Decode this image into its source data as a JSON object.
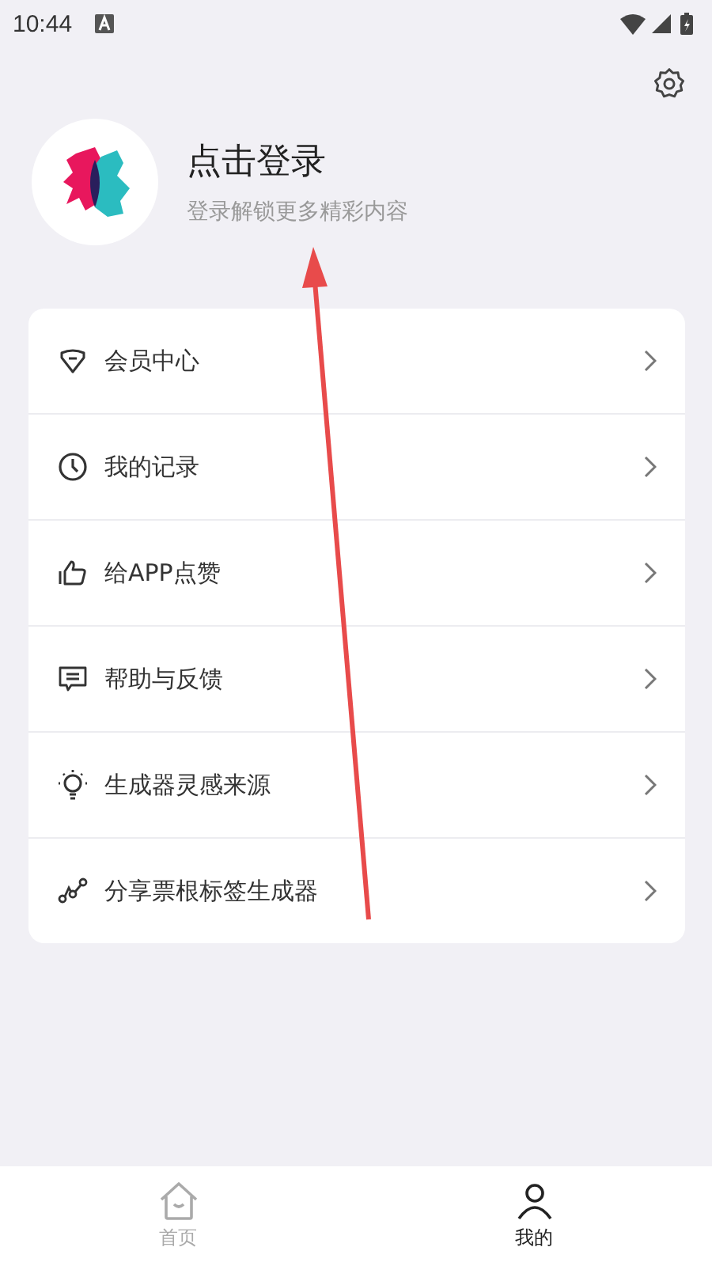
{
  "status_bar": {
    "time": "10:44"
  },
  "profile": {
    "title": "点击登录",
    "subtitle": "登录解锁更多精彩内容"
  },
  "menu": [
    {
      "kind": "member",
      "label": "会员中心"
    },
    {
      "kind": "history",
      "label": "我的记录"
    },
    {
      "kind": "like",
      "label": "给APP点赞"
    },
    {
      "kind": "feedback",
      "label": "帮助与反馈"
    },
    {
      "kind": "idea",
      "label": "生成器灵感来源"
    },
    {
      "kind": "share",
      "label": "分享票根标签生成器"
    }
  ],
  "tab_bar": [
    {
      "kind": "home",
      "label": "首页",
      "selected": false
    },
    {
      "kind": "me",
      "label": "我的",
      "selected": true
    }
  ]
}
